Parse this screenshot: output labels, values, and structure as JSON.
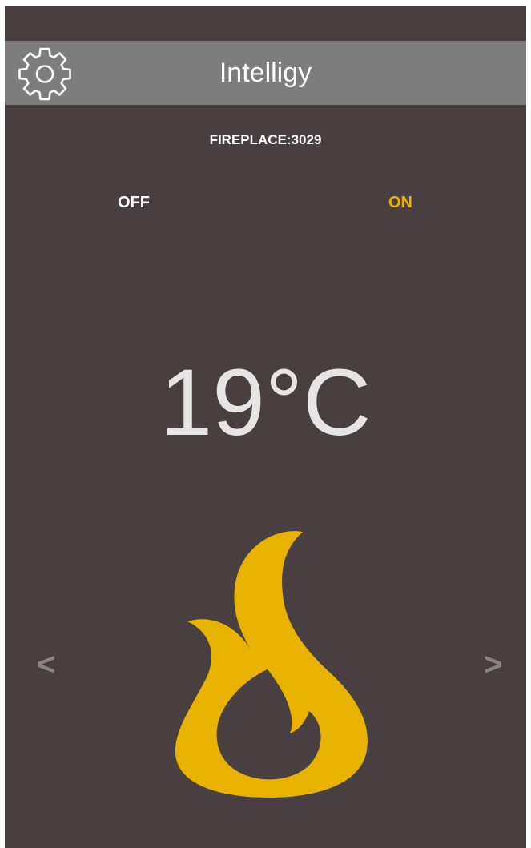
{
  "header": {
    "title": "Intelligy",
    "settings_icon": "gear-icon"
  },
  "device": {
    "label": "FIREPLACE:3029"
  },
  "power": {
    "off_label": "OFF",
    "on_label": "ON",
    "selected": "ON"
  },
  "temperature": {
    "display": "19°C"
  },
  "navigation": {
    "prev_label": "<",
    "next_label": ">"
  },
  "flame_icon": "flame-icon",
  "colors": {
    "background": "#493e40",
    "app_bar": "#7d7d7d",
    "accent": "#e8b300",
    "text": "#ffffff",
    "arrow": "#8a8384"
  }
}
